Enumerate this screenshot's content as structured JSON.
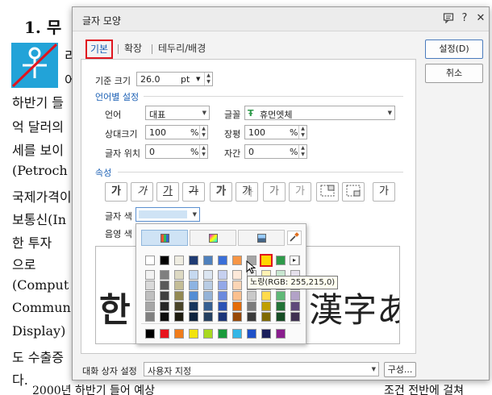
{
  "document": {
    "heading": "1. 무",
    "right_lines": [
      "리",
      "어"
    ],
    "lines": [
      "하반기 들",
      "억 달러의",
      "세를 보이",
      "(Petroch",
      "국제가격이",
      "보통신(In",
      "한 투자 ",
      "으로",
      "(Comput",
      "Commun",
      "Display)",
      "도 수출증",
      "다."
    ],
    "bottom_left": "2000년 하반기 들어 예상",
    "bottom_right": "조건 전반에 걸쳐"
  },
  "dialog": {
    "title": "글자 모양",
    "help_label": "?",
    "close_label": "✕",
    "tabs": [
      "기본",
      "확장",
      "테두리/배경"
    ],
    "base_size": {
      "label": "기준 크기",
      "value": "26.0",
      "unit": "pt"
    },
    "lang_section": "언어별 설정",
    "language": {
      "label": "언어",
      "value": "대표"
    },
    "font": {
      "label": "글꼴",
      "value": "휴먼엣체"
    },
    "relative_size": {
      "label": "상대크기",
      "value": "100",
      "unit": "%"
    },
    "width_ratio": {
      "label": "장평",
      "value": "100",
      "unit": "%"
    },
    "position": {
      "label": "글자 위치",
      "value": "0",
      "unit": "%"
    },
    "spacing": {
      "label": "자간",
      "value": "0",
      "unit": "%"
    },
    "attr_section": "속성",
    "attr_buttons": [
      "가",
      "가",
      "가",
      "가",
      "가",
      "가",
      "가",
      "가",
      "",
      "",
      "가"
    ],
    "text_color_label": "글자 색",
    "shade_color_label": "음영 색",
    "preview_left": "한",
    "preview_right": "漢字あ",
    "ok_button": "설정(D)",
    "cancel_button": "취소",
    "dialog_setting_label": "대화 상자 설정",
    "dialog_setting_value": "사용자 지정",
    "config_button": "구성..."
  },
  "palette": {
    "tooltip": "노랑(RGB: 255,215,0)",
    "more_arrow": "▸",
    "row1": [
      "#ffffff",
      "#000000",
      "#eeece1",
      "#1f3b73",
      "#4f81bd",
      "#3a6fd8",
      "#f79646",
      "#a5a5a5",
      "#ffd700",
      "#2e9a4a",
      "#8064a2"
    ],
    "columns": [
      [
        "#f2f2f2",
        "#d9d9d9",
        "#bfbfbf",
        "#a6a6a6",
        "#808080"
      ],
      [
        "#7f7f7f",
        "#595959",
        "#404040",
        "#262626",
        "#0d0d0d"
      ],
      [
        "#ddd9c3",
        "#c4bd97",
        "#938953",
        "#494429",
        "#1d1b10"
      ],
      [
        "#c6d9f0",
        "#8db3e2",
        "#548dd4",
        "#17365d",
        "#0f243e"
      ],
      [
        "#dbe5f1",
        "#b8cce4",
        "#95b3d7",
        "#366092",
        "#244061"
      ],
      [
        "#c6d0f0",
        "#93a8e8",
        "#6b8ade",
        "#2b53b5",
        "#1c3578"
      ],
      [
        "#fde9d9",
        "#fbd5b5",
        "#fac08f",
        "#e36c09",
        "#974806"
      ],
      [
        "#ededed",
        "#dbdbdb",
        "#c9c9c9",
        "#7b7b7b",
        "#3a3a3a"
      ],
      [
        "#fff2b3",
        "#ffe680",
        "#ffdb4d",
        "#bf9f00",
        "#7f6a00"
      ],
      [
        "#c8e7d0",
        "#93d0a3",
        "#5fb876",
        "#227337",
        "#164d25"
      ],
      [
        "#e5e0ec",
        "#ccc1d9",
        "#b2a2c7",
        "#5f497a",
        "#3f3151"
      ]
    ],
    "standard": [
      "#000000",
      "#e8141d",
      "#f07c1a",
      "#f2e30d",
      "#a9d91f",
      "#1a9b3c",
      "#33b6e6",
      "#1e50c8",
      "#1b1f5c",
      "#8a1e8e"
    ],
    "accent_color": "#1a5fb4",
    "highlight_color": "#e0141e"
  }
}
